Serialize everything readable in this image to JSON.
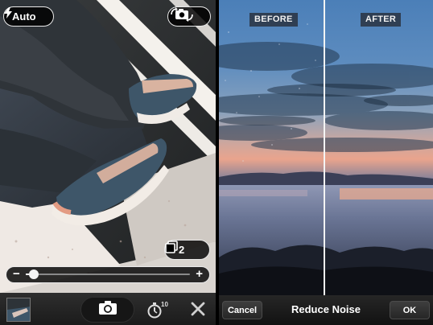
{
  "camera": {
    "flash": {
      "label": "Auto",
      "icon": "lightning-bolt-icon"
    },
    "flip_camera": {
      "icon": "camera-switch-icon"
    },
    "burst": {
      "count": "2",
      "icon": "stacked-photos-icon"
    },
    "zoom": {
      "minus_label": "−",
      "plus_label": "+",
      "level": 0.05
    },
    "toolbar": {
      "shutter_icon": "camera-icon",
      "timer_icon": "self-timer-icon",
      "timer_seconds": "10",
      "close_icon": "close-icon"
    }
  },
  "editor": {
    "before_label": "BEFORE",
    "after_label": "AFTER",
    "split_position": 0.49,
    "toolbar": {
      "cancel_label": "Cancel",
      "title": "Reduce Noise",
      "ok_label": "OK"
    }
  },
  "colors": {
    "sneaker": "#3e5669",
    "sky_top": "#4b7fb8",
    "sunset": "#e9a48d",
    "pill_border": "#e9e9e9"
  }
}
